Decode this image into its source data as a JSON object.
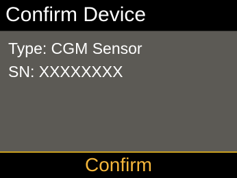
{
  "header": {
    "title": "Confirm Device"
  },
  "device_info": {
    "type_line": "Type: CGM Sensor",
    "serial_line": "SN: XXXXXXXX"
  },
  "softkey": {
    "label": "Confirm"
  },
  "colors": {
    "screen_background": "#5c5a55",
    "bar_background": "#000000",
    "text": "#ffffff",
    "accent": "#f4b63b"
  }
}
